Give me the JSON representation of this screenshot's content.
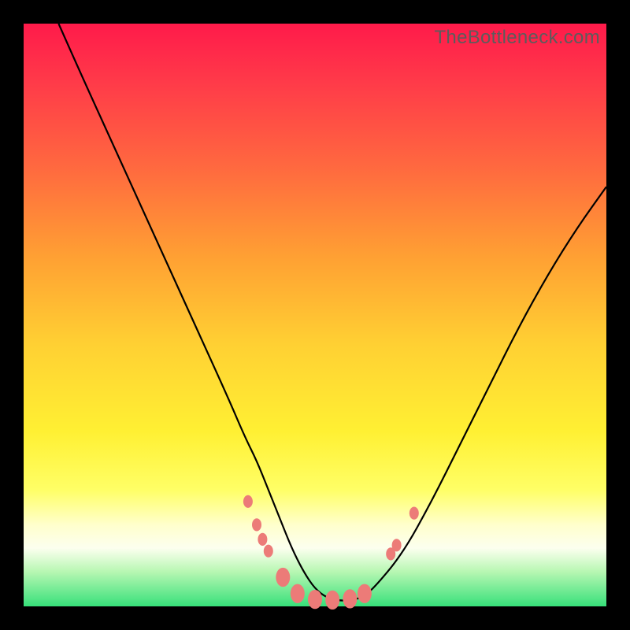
{
  "watermark": "TheBottleneck.com",
  "chart_data": {
    "type": "line",
    "title": "",
    "xlabel": "",
    "ylabel": "",
    "xlim": [
      0,
      100
    ],
    "ylim": [
      0,
      100
    ],
    "grid": false,
    "legend": false,
    "series": [
      {
        "name": "curve",
        "x": [
          6,
          10,
          15,
          20,
          25,
          30,
          35,
          38,
          40,
          42,
          44,
          46,
          48,
          50,
          52,
          54,
          56,
          58,
          60,
          65,
          70,
          75,
          80,
          85,
          90,
          95,
          100
        ],
        "y": [
          100,
          91,
          80,
          69,
          58,
          47,
          36,
          29,
          25,
          20,
          15,
          10,
          6,
          3,
          1.5,
          1,
          1,
          1.5,
          3,
          9,
          18,
          28,
          38,
          48,
          57,
          65,
          72
        ]
      }
    ],
    "markers": [
      {
        "x": 38.5,
        "y": 18,
        "size": "small"
      },
      {
        "x": 40,
        "y": 14,
        "size": "small"
      },
      {
        "x": 41,
        "y": 11.5,
        "size": "small"
      },
      {
        "x": 42,
        "y": 9.5,
        "size": "small"
      },
      {
        "x": 44.5,
        "y": 5,
        "size": "med"
      },
      {
        "x": 47,
        "y": 2.2,
        "size": "med"
      },
      {
        "x": 50,
        "y": 1.2,
        "size": "med"
      },
      {
        "x": 53,
        "y": 1.1,
        "size": "med"
      },
      {
        "x": 56,
        "y": 1.3,
        "size": "med"
      },
      {
        "x": 58.5,
        "y": 2.2,
        "size": "med"
      },
      {
        "x": 63,
        "y": 9,
        "size": "small"
      },
      {
        "x": 64,
        "y": 10.5,
        "size": "small"
      },
      {
        "x": 67,
        "y": 16,
        "size": "small"
      }
    ],
    "background_gradient": {
      "type": "vertical",
      "stops": [
        {
          "pos": 0.0,
          "color": "#ff1a4a"
        },
        {
          "pos": 0.25,
          "color": "#ff6a3f"
        },
        {
          "pos": 0.55,
          "color": "#ffd033"
        },
        {
          "pos": 0.8,
          "color": "#ffff66"
        },
        {
          "pos": 0.9,
          "color": "#fcffef"
        },
        {
          "pos": 1.0,
          "color": "#37e07a"
        }
      ]
    }
  }
}
